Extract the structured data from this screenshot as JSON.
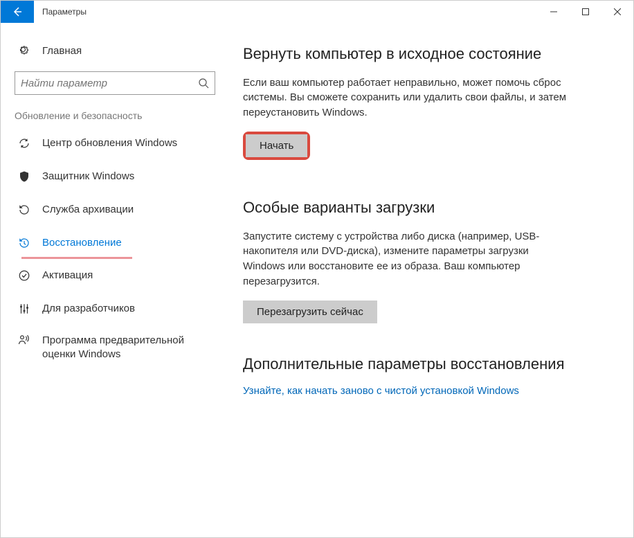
{
  "titlebar": {
    "title": "Параметры"
  },
  "sidebar": {
    "home_label": "Главная",
    "search_placeholder": "Найти параметр",
    "category_label": "Обновление и безопасность",
    "items": [
      {
        "label": "Центр обновления Windows"
      },
      {
        "label": "Защитник Windows"
      },
      {
        "label": "Служба архивации"
      },
      {
        "label": "Восстановление"
      },
      {
        "label": "Активация"
      },
      {
        "label": "Для разработчиков"
      },
      {
        "label": "Программа предварительной оценки Windows"
      }
    ]
  },
  "content": {
    "reset": {
      "heading": "Вернуть компьютер в исходное состояние",
      "text": "Если ваш компьютер работает неправильно, может помочь сброс системы. Вы сможете сохранить или удалить свои файлы, и затем переустановить Windows.",
      "button": "Начать"
    },
    "advanced_startup": {
      "heading": "Особые варианты загрузки",
      "text": "Запустите систему с устройства либо диска (например, USB-накопителя или DVD-диска), измените параметры загрузки Windows или восстановите ее из образа. Ваш компьютер перезагрузится.",
      "button": "Перезагрузить сейчас"
    },
    "more": {
      "heading": "Дополнительные параметры восстановления",
      "link": "Узнайте, как начать заново с чистой установкой Windows"
    }
  }
}
